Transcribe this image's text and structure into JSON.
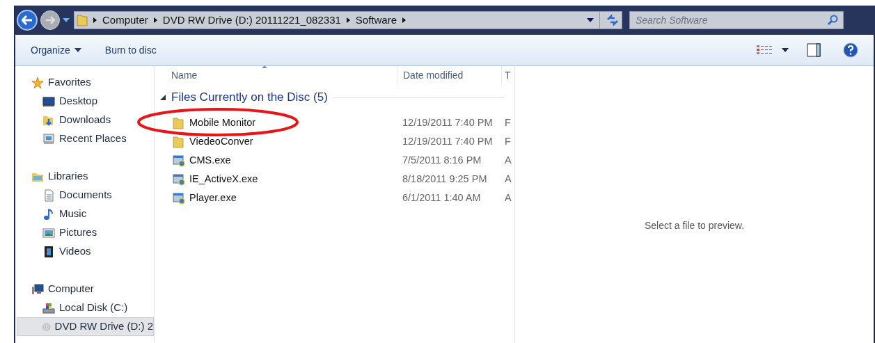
{
  "address_bar": {
    "crumbs": [
      "Computer",
      "DVD RW Drive (D:) 20111221_082331",
      "Software"
    ]
  },
  "search": {
    "placeholder": "Search Software"
  },
  "toolbar": {
    "buttons": [
      {
        "label": "Organize",
        "dropdown": true
      },
      {
        "label": "Burn to disc",
        "dropdown": false
      }
    ]
  },
  "sidebar": {
    "groups": [
      {
        "label": "Favorites",
        "items": [
          {
            "label": "Desktop",
            "selected": false
          },
          {
            "label": "Downloads",
            "selected": false
          },
          {
            "label": "Recent Places",
            "selected": false
          }
        ]
      },
      {
        "label": "Libraries",
        "items": [
          {
            "label": "Documents",
            "selected": false
          },
          {
            "label": "Music",
            "selected": false
          },
          {
            "label": "Pictures",
            "selected": false
          },
          {
            "label": "Videos",
            "selected": false
          }
        ]
      },
      {
        "label": "Computer",
        "items": [
          {
            "label": "Local Disk (C:)",
            "selected": false
          },
          {
            "label": "DVD RW Drive (D:) 2",
            "selected": true
          }
        ]
      }
    ]
  },
  "table": {
    "columns": [
      "Name",
      "Date modified",
      "T"
    ],
    "group": {
      "label": "Files Currently on the Disc (5)"
    },
    "rows": [
      {
        "kind": "folder",
        "name": "Mobile Monitor",
        "date": "12/19/2011 7:40 PM",
        "column_3": "F",
        "highlighted": true
      },
      {
        "kind": "folder",
        "name": "ViedeoConver",
        "date": "12/19/2011 7:40 PM",
        "column_3": "F",
        "highlighted": false
      },
      {
        "kind": "exe",
        "name": "CMS.exe",
        "date": "7/5/2011 8:16 PM",
        "column_3": "A",
        "highlighted": false
      },
      {
        "kind": "exe",
        "name": "IE_ActiveX.exe",
        "date": "8/18/2011 9:25 PM",
        "column_3": "A",
        "highlighted": false
      },
      {
        "kind": "exe",
        "name": "Player.exe",
        "date": "6/1/2011 1:40 AM",
        "column_3": "A",
        "highlighted": false
      }
    ]
  },
  "preview": {
    "message": "Select a file to preview."
  }
}
